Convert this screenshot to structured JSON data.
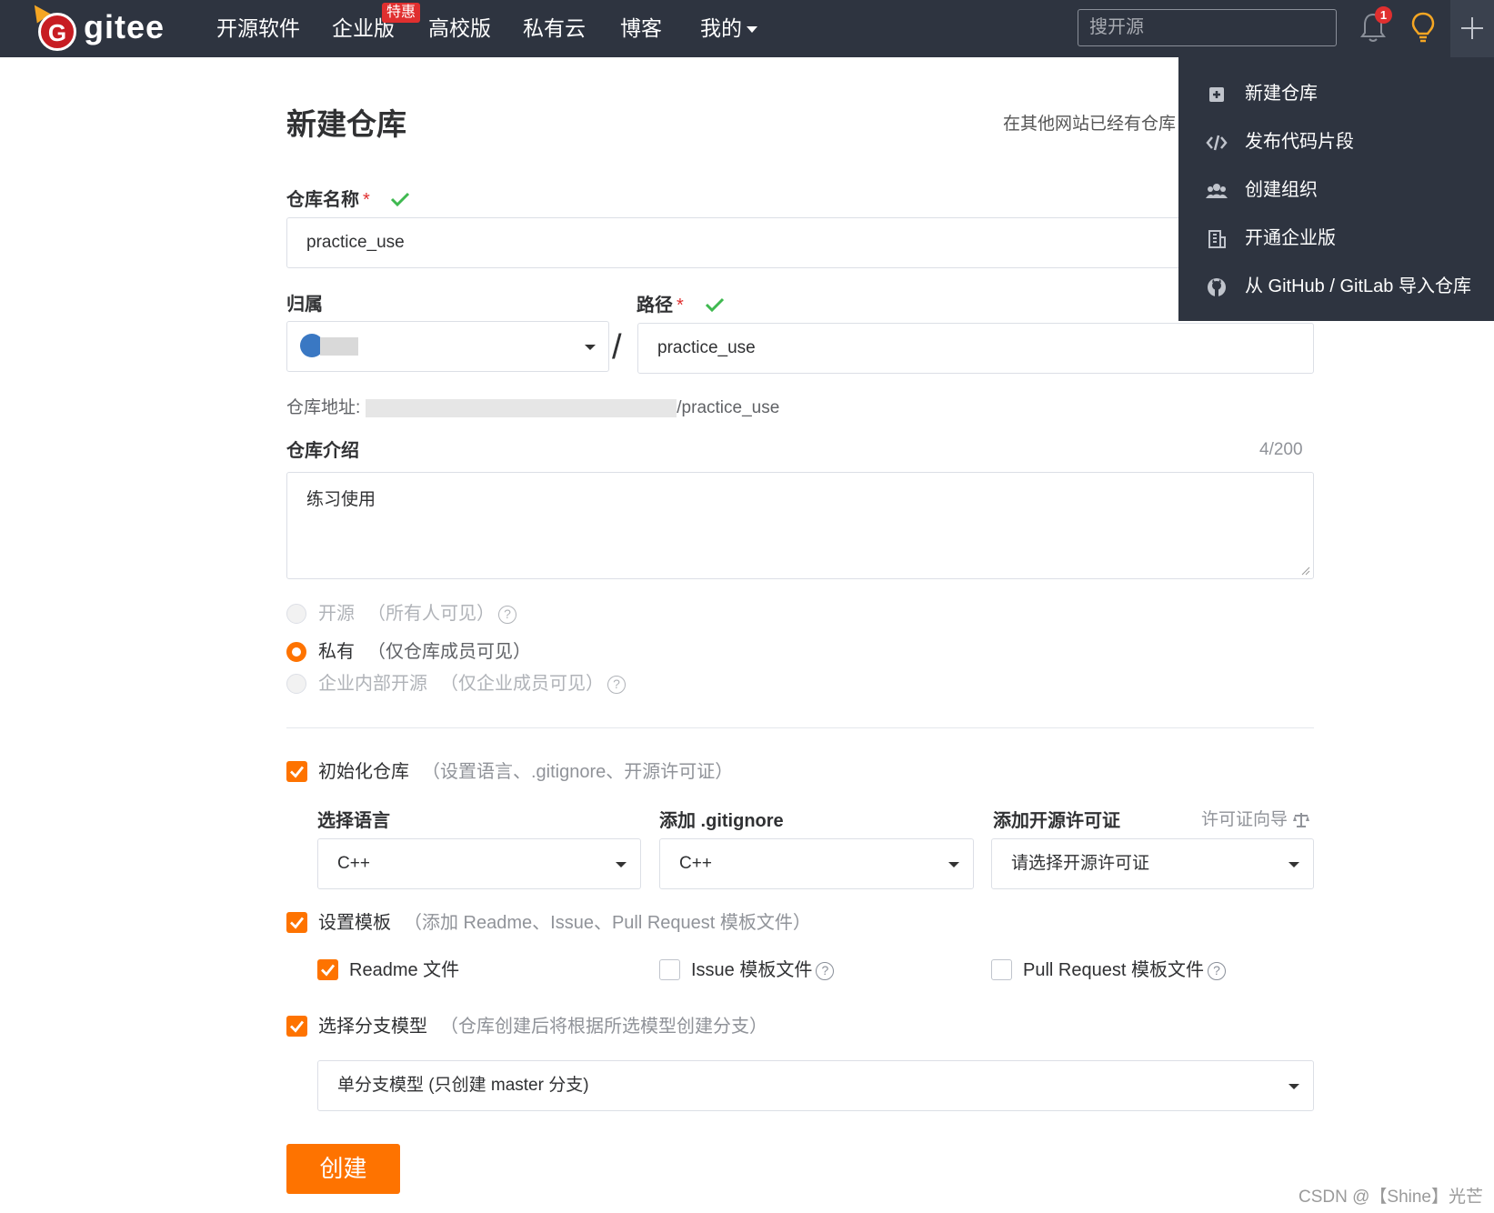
{
  "header": {
    "logo_text": "gitee",
    "nav": [
      {
        "label": "开源软件"
      },
      {
        "label": "企业版",
        "badge": "特惠"
      },
      {
        "label": "高校版"
      },
      {
        "label": "私有云"
      },
      {
        "label": "博客"
      },
      {
        "label": "我的"
      }
    ],
    "search_placeholder": "搜开源",
    "notification_count": "1",
    "icons": [
      "bell-icon",
      "bulb-icon",
      "plus-icon"
    ]
  },
  "dropdown": {
    "items": [
      {
        "label": "新建仓库",
        "icon": "plus-square-icon"
      },
      {
        "label": "发布代码片段",
        "icon": "code-icon"
      },
      {
        "label": "创建组织",
        "icon": "users-icon"
      },
      {
        "label": "开通企业版",
        "icon": "building-icon"
      },
      {
        "label": "从 GitHub / GitLab 导入仓库",
        "icon": "github-icon"
      }
    ]
  },
  "form": {
    "title": "新建仓库",
    "import_hint": "在其他网站已经有仓库",
    "repo_name": {
      "label": "仓库名称",
      "required": "*",
      "value": "practice_use"
    },
    "owner": {
      "label": "归属"
    },
    "path": {
      "label": "路径",
      "required": "*",
      "value": "practice_use",
      "separator": "/"
    },
    "address": {
      "label": "仓库地址:",
      "suffix": "/practice_use"
    },
    "description": {
      "label": "仓库介绍",
      "counter": "4/200",
      "value": "练习使用"
    },
    "visibility": [
      {
        "label": "开源",
        "hint": "（所有人可见）",
        "selected": false,
        "disabled": true,
        "help": "?"
      },
      {
        "label": "私有",
        "hint": "（仅仓库成员可见）",
        "selected": true,
        "disabled": false
      },
      {
        "label": "企业内部开源",
        "hint": "（仅企业成员可见）",
        "selected": false,
        "disabled": true,
        "help": "?"
      }
    ],
    "init_repo": {
      "label": "初始化仓库",
      "hint": "（设置语言、.gitignore、开源许可证）",
      "checked": true
    },
    "language": {
      "label": "选择语言",
      "value": "C++"
    },
    "gitignore": {
      "label": "添加 .gitignore",
      "value": "C++"
    },
    "license": {
      "label": "添加开源许可证",
      "guide": "许可证向导",
      "value": "请选择开源许可证"
    },
    "template": {
      "label": "设置模板",
      "hint": "（添加 Readme、Issue、Pull Request 模板文件）",
      "checked": true
    },
    "template_options": [
      {
        "label": "Readme 文件",
        "checked": true
      },
      {
        "label": "Issue 模板文件",
        "checked": false,
        "help": "?"
      },
      {
        "label": "Pull Request 模板文件",
        "checked": false,
        "help": "?"
      }
    ],
    "branch": {
      "label": "选择分支模型",
      "hint": "（仓库创建后将根据所选模型创建分支）",
      "checked": true,
      "value": "单分支模型 (只创建 master 分支)"
    },
    "submit_label": "创建"
  },
  "watermark": "CSDN @【Shine】光芒",
  "colors": {
    "accent": "#fe7300",
    "nav_bg": "#2e3440",
    "success": "#3fb950",
    "badge": "#e02f2f"
  }
}
